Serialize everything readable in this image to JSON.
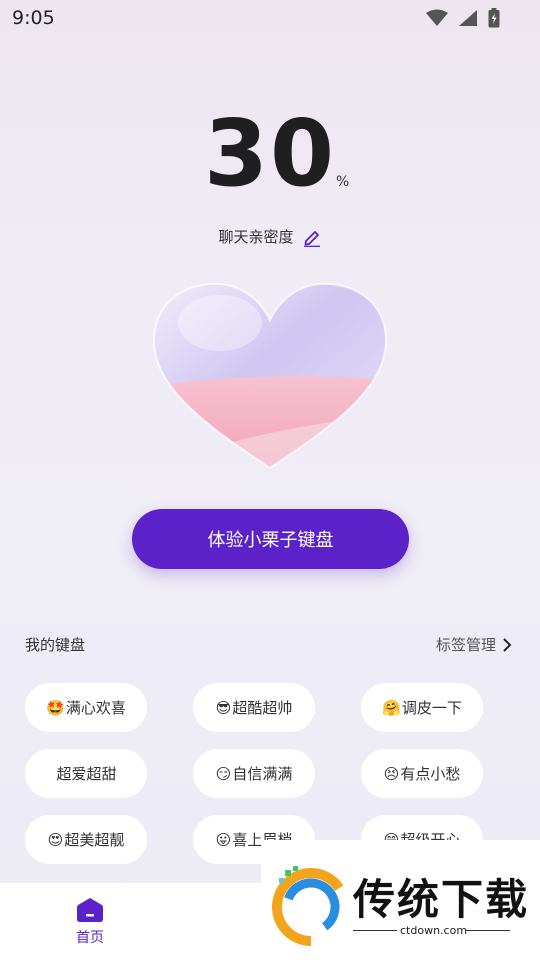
{
  "status_bar": {
    "time": "9:05"
  },
  "score": {
    "value": "30",
    "unit": "%"
  },
  "intimacy": {
    "label": "聊天亲密度"
  },
  "cta": {
    "label": "体验小栗子键盘"
  },
  "keyboard_section": {
    "title": "我的键盘",
    "manage_label": "标签管理",
    "tags": [
      {
        "emoji": "🤩",
        "label": "满心欢喜"
      },
      {
        "emoji": "😎",
        "label": "超酷超帅"
      },
      {
        "emoji": "🤗",
        "label": "调皮一下"
      },
      {
        "emoji": "",
        "label": "超爱超甜"
      },
      {
        "emoji": "😏",
        "label": "自信满满"
      },
      {
        "emoji": "😣",
        "label": "有点小愁"
      },
      {
        "emoji": "😍",
        "label": "超美超靓"
      },
      {
        "emoji": "😛",
        "label": "喜上眉梢"
      },
      {
        "emoji": "😄",
        "label": "超级开心"
      }
    ]
  },
  "tabbar": {
    "home_label": "首页"
  },
  "watermark": {
    "text": "传统下载",
    "url": "ctdown.com"
  },
  "colors": {
    "accent": "#5a22c8",
    "heart_pink": "#f6b7c9",
    "heart_lavender": "#c9c2f0"
  }
}
